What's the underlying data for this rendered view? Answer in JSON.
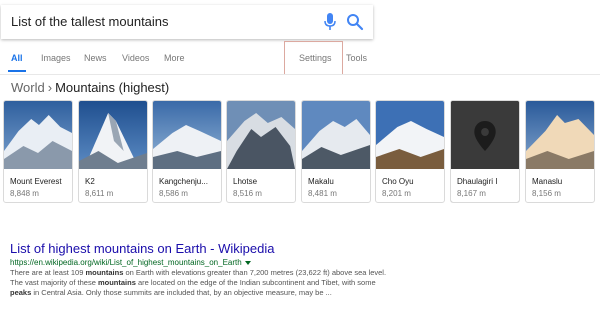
{
  "search": {
    "query": "List of the tallest mountains",
    "mic_icon": "mic-icon",
    "search_icon": "search-icon",
    "accent_color": "#1a73e8"
  },
  "tabs": [
    {
      "label": "All",
      "active": true
    },
    {
      "label": "Images"
    },
    {
      "label": "News"
    },
    {
      "label": "Videos"
    },
    {
      "label": "More"
    },
    {
      "label": "Settings"
    },
    {
      "label": "Tools"
    }
  ],
  "breadcrumb": {
    "world": "World",
    "separator": "›",
    "current": "Mountains (highest)"
  },
  "mountains": [
    {
      "name": "Mount Everest",
      "elevation": "8,848 m"
    },
    {
      "name": "K2",
      "elevation": "8,611 m"
    },
    {
      "name": "Kangchenju...",
      "elevation": "8,586 m"
    },
    {
      "name": "Lhotse",
      "elevation": "8,516 m"
    },
    {
      "name": "Makalu",
      "elevation": "8,481 m"
    },
    {
      "name": "Cho Oyu",
      "elevation": "8,201 m"
    },
    {
      "name": "Dhaulagiri I",
      "elevation": "8,167 m"
    },
    {
      "name": "Manaslu",
      "elevation": "8,156 m"
    }
  ],
  "result": {
    "title": "List of highest mountains on Earth - Wikipedia",
    "url": "https://en.wikipedia.org/wiki/List_of_highest_mountains_on_Earth",
    "snippet": {
      "s1": "There are at least 109 ",
      "b1": "mountains",
      "s2": " on Earth with elevations greater than 7,200 metres (23,622 ft) above sea level. The vast majority of these ",
      "b2": "mountains",
      "s3": " are located on the edge of the Indian subcontinent and Tibet, with some ",
      "b3": "peaks",
      "s4": " in Central Asia. Only those summits are included that, by an objective measure, may be ..."
    },
    "link_color": "#1a0dab",
    "url_color": "#006621"
  }
}
